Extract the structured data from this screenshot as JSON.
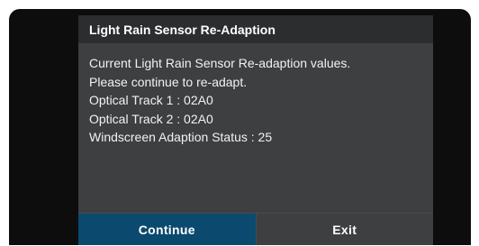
{
  "dialog": {
    "title": "Light Rain Sensor Re-Adaption",
    "lines": [
      "Current Light Rain Sensor Re-adaption values.",
      "Please continue to re-adapt.",
      "Optical Track 1 : 02A0",
      "Optical Track 2 : 02A0",
      "Windscreen Adaption Status : 25"
    ],
    "buttons": {
      "continue_label": "Continue",
      "exit_label": "Exit"
    }
  },
  "colors": {
    "accent_button": "#0b4a6e",
    "dialog_background": "#3d3f41",
    "header_background": "#2b2d2f",
    "screen_background": "#0d0d0d"
  }
}
